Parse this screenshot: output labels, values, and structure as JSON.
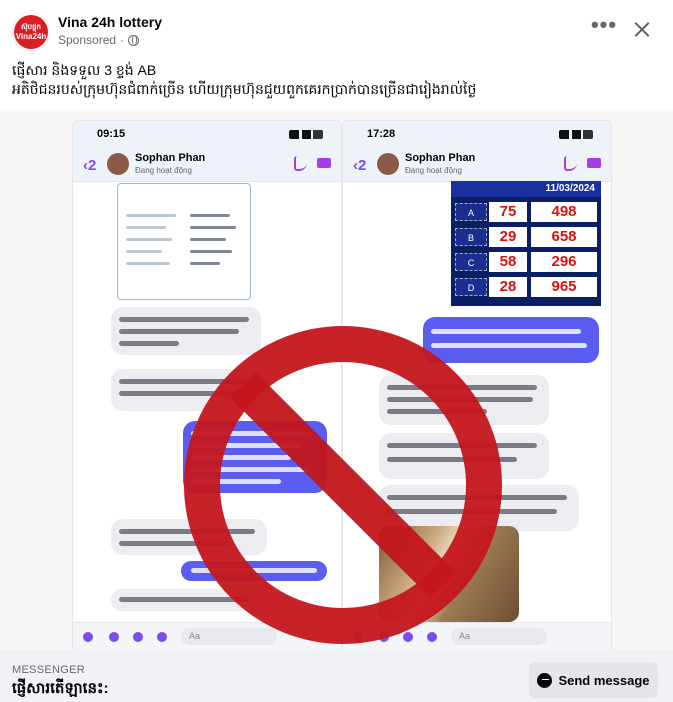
{
  "post": {
    "avatar_line1": "ស៊ុបផ្ចុក",
    "avatar_line2": "Vina24h",
    "page_name": "Vina 24h lottery",
    "sponsored": "Sponsored",
    "more_label": "•••",
    "caption_line1": "ផ្ញើសារ និងទទួល 3 ខ្ទង់ AB",
    "caption_line2": "អតិថិជនរបស់ក្រុមហ៊ុនជំពាក់ច្រើន ហើយក្រុមហ៊ុនជួយពួកគេរកប្រាក់បានច្រើនជារៀងរាល់ថ្ងៃ"
  },
  "image": {
    "left_phone": {
      "time": "09:15",
      "contact": "Sophan Phan",
      "status": "Đang hoạt động",
      "compose": "Aa"
    },
    "right_phone": {
      "time": "17:28",
      "contact": "Sophan Phan",
      "status": "Đang hoạt động",
      "compose": "Aa",
      "lottery_date": "11/03/2024",
      "rows": [
        {
          "label": "A",
          "two": "75",
          "three": "498"
        },
        {
          "label": "B",
          "two": "29",
          "three": "658"
        },
        {
          "label": "C",
          "two": "58",
          "three": "296"
        },
        {
          "label": "D",
          "two": "28",
          "three": "965"
        }
      ]
    },
    "overlay_icon": "prohibited-sign-icon",
    "overlay_color": "#c4161c"
  },
  "footer": {
    "label": "MESSENGER",
    "prompt": "ផ្ញើសារតើឡានេះ:",
    "send_label": "Send message",
    "send_icon": "messenger-icon"
  }
}
